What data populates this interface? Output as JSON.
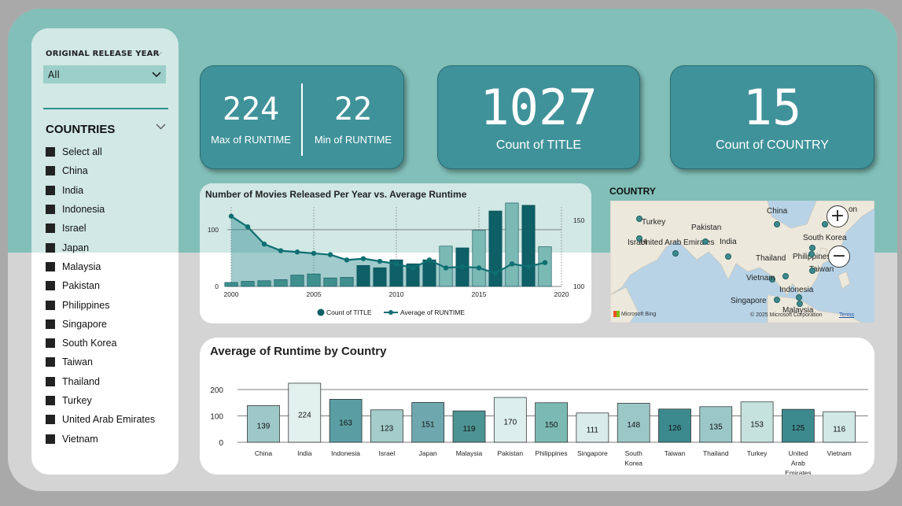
{
  "filters": {
    "year_label": "ORIGINAL RELEASE YEAR",
    "year_value": "All",
    "countries_title": "COUNTRIES",
    "items": [
      "Select all",
      "China",
      "India",
      "Indonesia",
      "Israel",
      "Japan",
      "Malaysia",
      "Pakistan",
      "Philippines",
      "Singapore",
      "South Korea",
      "Taiwan",
      "Thailand",
      "Turkey",
      "United Arab Emirates",
      "Vietnam"
    ]
  },
  "kpis": {
    "max_runtime": "224",
    "max_runtime_label": "Max of RUNTIME",
    "min_runtime": "22",
    "min_runtime_label": "Min of RUNTIME",
    "count_title": "1027",
    "count_title_label": "Count of TITLE",
    "count_country": "15",
    "count_country_label": "Count of COUNTRY"
  },
  "chart_data": [
    {
      "type": "bar",
      "title": "Number of Movies Released Per Year vs. Average Runtime",
      "x": [
        2000,
        2001,
        2002,
        2003,
        2004,
        2005,
        2006,
        2007,
        2008,
        2009,
        2010,
        2011,
        2012,
        2013,
        2014,
        2015,
        2016,
        2017,
        2018,
        2019
      ],
      "xticks": [
        "2000",
        "2005",
        "2010",
        "2015",
        "2020"
      ],
      "yticks_left": [
        "0",
        "100"
      ],
      "yticks_right": [
        "100",
        "150"
      ],
      "ylim_left": [
        0,
        140
      ],
      "ylim_right": [
        100,
        160
      ],
      "series": [
        {
          "name": "Count of TITLE",
          "axis": "left",
          "kind": "bar",
          "values": [
            7,
            9,
            10,
            12,
            20,
            22,
            15,
            16,
            37,
            33,
            47,
            40,
            47,
            71,
            68,
            99,
            133,
            147,
            143,
            70
          ]
        },
        {
          "name": "Average of RUNTIME",
          "axis": "right",
          "kind": "line",
          "values": [
            153,
            145,
            132,
            127,
            126,
            125,
            124,
            120,
            121,
            119,
            117,
            114,
            120,
            114,
            115,
            114,
            110,
            117,
            115,
            118
          ]
        }
      ],
      "legend": "bottom",
      "colors": [
        "#0e5f66",
        "#3f8f8f",
        "#7bb9b4"
      ]
    },
    {
      "type": "bar",
      "title": "Average of Runtime by Country",
      "categories": [
        "China",
        "India",
        "Indonesia",
        "Israel",
        "Japan",
        "Malaysia",
        "Pakistan",
        "Philippines",
        "Singapore",
        "South Korea",
        "Taiwan",
        "Thailand",
        "Turkey",
        "United Arab Emirates",
        "Vietnam"
      ],
      "values": [
        139,
        224,
        163,
        123,
        151,
        119,
        170,
        150,
        111,
        148,
        126,
        135,
        153,
        125,
        116
      ],
      "yticks": [
        "0",
        "100",
        "200"
      ],
      "ylim": [
        0,
        230
      ],
      "grid": true,
      "colors": [
        "#9ec8c8",
        "#e2f0ee",
        "#5a9ea3",
        "#a3ccca",
        "#6ea8ae",
        "#4e9393",
        "#dcefec",
        "#7bbab3",
        "#d9ecea",
        "#9cc7c7",
        "#3d8a8e",
        "#9cc7c7",
        "#c6e2de",
        "#3d8a8e",
        "#d1e8e5"
      ]
    }
  ],
  "map": {
    "title": "COUNTRY",
    "labels": [
      "Israel",
      "Turkey",
      "United Arab Emirates",
      "Pakistan",
      "India",
      "China",
      "South Korea",
      "Thailand",
      "Philippines",
      "Vietnam",
      "Taiwan",
      "Indonesia",
      "Singapore",
      "Malaysia",
      "on"
    ],
    "zoom_in": "+",
    "zoom_out": "−",
    "provider": "Microsoft Bing",
    "copyright": "© 2025 Microsoft Corporation",
    "terms": "Terms"
  }
}
